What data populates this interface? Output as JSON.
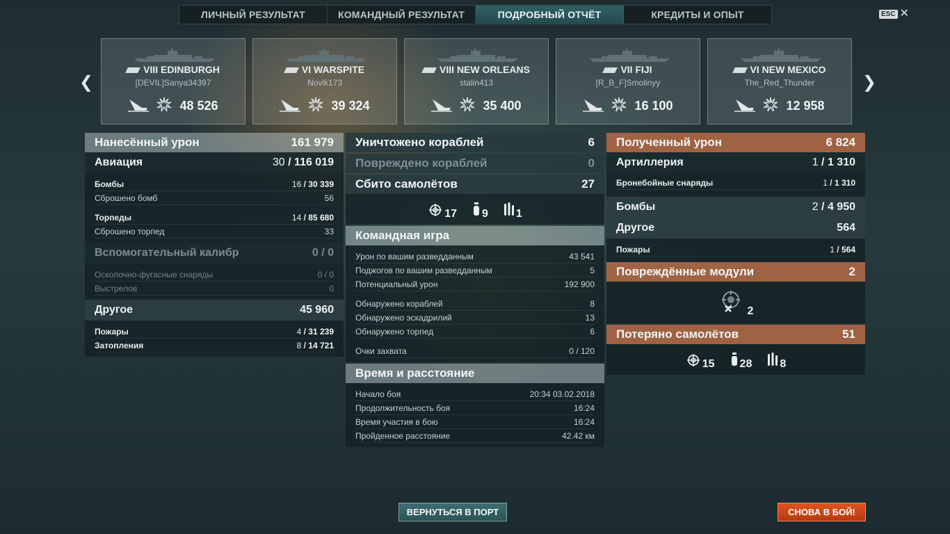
{
  "tabs": [
    "ЛИЧНЫЙ РЕЗУЛЬТАТ",
    "КОМАНДНЫЙ РЕЗУЛЬТАТ",
    "ПОДРОБНЫЙ ОТЧЁТ",
    "КРЕДИТЫ И ОПЫТ"
  ],
  "active_tab": 2,
  "esc_label": "ESC",
  "ships": [
    {
      "name": "VIII EDINBURGH",
      "player": "[DEVIL]Sanya34397",
      "damage": "48 526"
    },
    {
      "name": "VI WARSPITE",
      "player": "Novik173",
      "damage": "39 324"
    },
    {
      "name": "VIII NEW ORLEANS",
      "player": "stalin413",
      "damage": "35 400"
    },
    {
      "name": "VII FIJI",
      "player": "[R_B_F]Smolinyy",
      "damage": "16 100"
    },
    {
      "name": "VI NEW MEXICO",
      "player": "The_Red_Thunder",
      "damage": "12 958"
    }
  ],
  "left": {
    "header": {
      "label": "Нанесённый урон",
      "value": "161 979"
    },
    "aviation": {
      "label": "Авиация",
      "hits": "30",
      "value": "116 019"
    },
    "bombs": {
      "label": "Бомбы",
      "hits": "16",
      "value": "30 339"
    },
    "bombs_dropped": {
      "label": "Сброшено бомб",
      "value": "56"
    },
    "torpedoes": {
      "label": "Торпеды",
      "hits": "14",
      "value": "85 680"
    },
    "torpedoes_dropped": {
      "label": "Сброшено торпед",
      "value": "33"
    },
    "secondary": {
      "label": "Вспомогательный калибр",
      "value": "0 / 0"
    },
    "he_shells": {
      "label": "Осколочно-фугасные снаряды",
      "value": "0 / 0"
    },
    "shots": {
      "label": "Выстрелов",
      "value": "0"
    },
    "other": {
      "label": "Другое",
      "value": "45 960"
    },
    "fires": {
      "label": "Пожары",
      "hits": "4",
      "value": "31 239"
    },
    "floods": {
      "label": "Затопления",
      "hits": "8",
      "value": "14 721"
    }
  },
  "middle": {
    "destroyed": {
      "label": "Уничтожено кораблей",
      "value": "6"
    },
    "damaged": {
      "label": "Повреждено кораблей",
      "value": "0"
    },
    "planes_shot": {
      "label": "Сбито самолётов",
      "value": "27"
    },
    "planes_icons": [
      {
        "icon": "fighter-icon",
        "value": "17"
      },
      {
        "icon": "bomber-icon",
        "value": "9"
      },
      {
        "icon": "torpedo-bomber-icon",
        "value": "1"
      }
    ],
    "team_play": {
      "label": "Командная игра",
      "rows": [
        {
          "label": "Урон по вашим разведданным",
          "value": "43 541"
        },
        {
          "label": "Поджогов по вашим разведданным",
          "value": "5"
        },
        {
          "label": "Потенциальный урон",
          "value": "192 900"
        },
        {
          "label": "Обнаружено кораблей",
          "value": "8"
        },
        {
          "label": "Обнаружено эскадрилий",
          "value": "13"
        },
        {
          "label": "Обнаружено торпед",
          "value": "6"
        },
        {
          "label": "Очки захвата",
          "value": "0 / 120"
        }
      ]
    },
    "time": {
      "label": "Время и расстояние",
      "rows": [
        {
          "label": "Начало боя",
          "value": "20:34  03.02.2018"
        },
        {
          "label": "Продолжительность боя",
          "value": "16:24"
        },
        {
          "label": "Время участия в бою",
          "value": "16:24"
        },
        {
          "label": "Пройденное расстояние",
          "value": "42.42 км"
        }
      ]
    }
  },
  "right": {
    "received": {
      "label": "Полученный урон",
      "value": "6 824"
    },
    "artillery": {
      "label": "Артиллерия",
      "hits": "1",
      "value": "1 310"
    },
    "ap_shells": {
      "label": "Бронебойные снаряды",
      "hits": "1",
      "value": "1 310"
    },
    "bombs": {
      "label": "Бомбы",
      "hits": "2",
      "value": "4 950"
    },
    "other": {
      "label": "Другое",
      "value": "564"
    },
    "fires": {
      "label": "Пожары",
      "hits": "1",
      "value": "564"
    },
    "modules": {
      "label": "Повреждённые модули",
      "value": "2"
    },
    "module_icon_value": "2",
    "planes_lost": {
      "label": "Потеряно самолётов",
      "value": "51"
    },
    "planes_icons": [
      {
        "icon": "fighter-icon",
        "value": "15"
      },
      {
        "icon": "bomber-icon",
        "value": "28"
      },
      {
        "icon": "torpedo-bomber-icon",
        "value": "8"
      }
    ]
  },
  "buttons": {
    "port": "ВЕРНУТЬСЯ В ПОРТ",
    "battle": "СНОВА В БОЙ!"
  }
}
